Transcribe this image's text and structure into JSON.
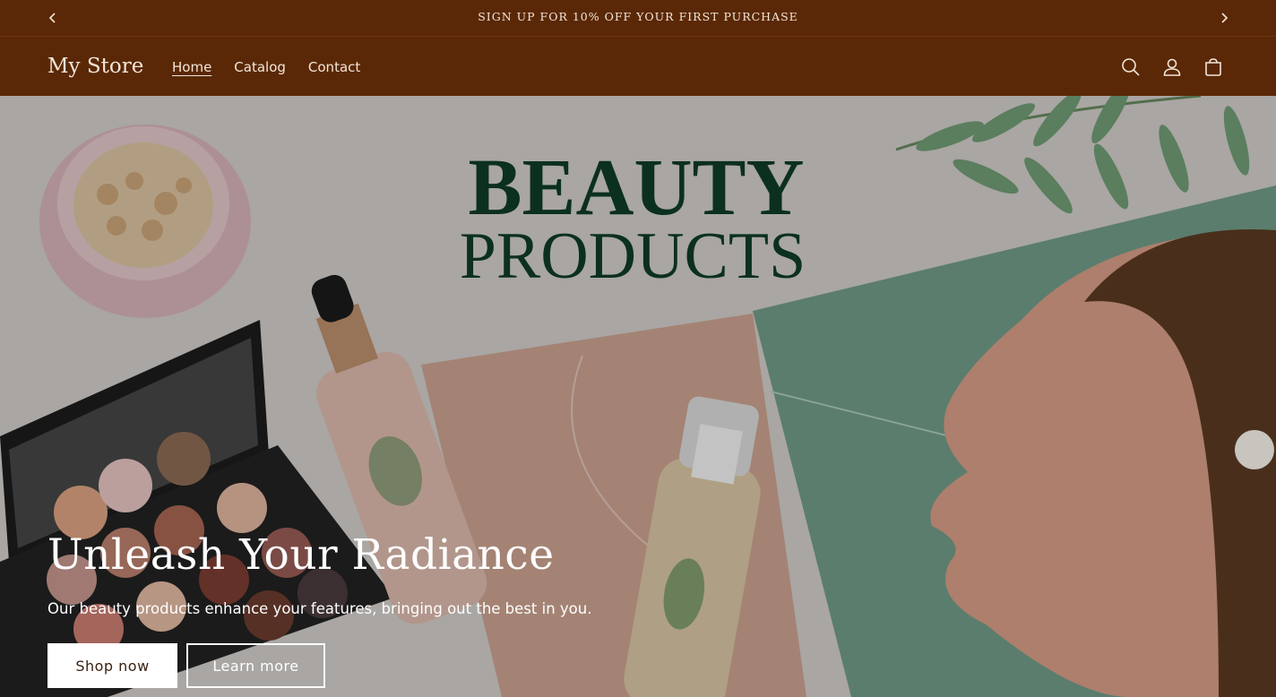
{
  "announcement": {
    "text": "SIGN UP FOR 10% OFF YOUR FIRST PURCHASE",
    "prev_icon": "chevron-left-icon",
    "next_icon": "chevron-right-icon"
  },
  "header": {
    "logo": "My Store",
    "nav": [
      {
        "label": "Home",
        "active": true
      },
      {
        "label": "Catalog",
        "active": false
      },
      {
        "label": "Contact",
        "active": false
      }
    ],
    "icons": [
      "search-icon",
      "account-icon",
      "cart-icon"
    ]
  },
  "hero": {
    "image_text_line1": "BEAUTY",
    "image_text_line2": "PRODUCTS",
    "title": "Unleash Your Radiance",
    "subtitle": "Our beauty products enhance your features, bringing out the best in you.",
    "primary_button": "Shop now",
    "secondary_button": "Learn more"
  },
  "colors": {
    "header_bg": "#5a2806",
    "header_text": "#f3e6d8",
    "image_title": "#0f3b25"
  }
}
